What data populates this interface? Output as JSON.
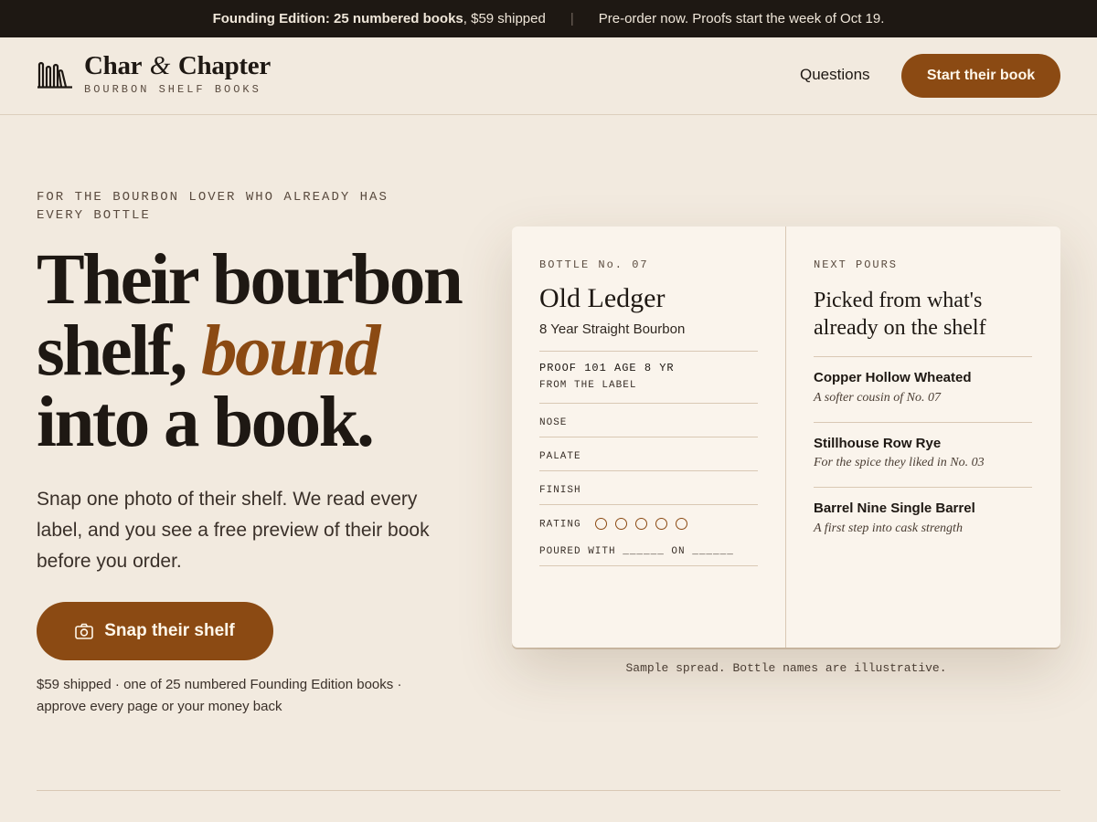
{
  "announcement": {
    "bold": "Founding Edition: 25 numbered books",
    "rest": ", $59 shipped",
    "divider": "|",
    "preorder": "Pre-order now. Proofs start the week of Oct 19."
  },
  "header": {
    "brand_part1": "Char",
    "brand_amp": "&",
    "brand_part2": "Chapter",
    "tagline": "BOURBON SHELF BOOKS",
    "nav_questions": "Questions",
    "cta": "Start their book"
  },
  "hero": {
    "eyebrow": "FOR THE BOURBON LOVER WHO ALREADY HAS EVERY BOTTLE",
    "headline_line1": "Their bourbon",
    "headline_line2_a": "shelf, ",
    "headline_line2_accent": "bound",
    "headline_line3": "into a book.",
    "subcopy": "Snap one photo of their shelf. We read every label, and you see a free preview of their book before you order.",
    "button": "Snap their shelf",
    "fineprint": "$59 shipped · one of 25 numbered Founding Edition books · approve every page or your money back"
  },
  "spread": {
    "left": {
      "bottle_no": "BOTTLE No. 07",
      "name": "Old Ledger",
      "type": "8 Year Straight Bourbon",
      "proof_age": "PROOF 101  AGE 8 YR",
      "from_label": "FROM THE LABEL",
      "nose": "NOSE",
      "palate": "PALATE",
      "finish": "FINISH",
      "rating": "RATING",
      "rating_slots": 5,
      "poured": "POURED WITH ______ ON ______"
    },
    "right": {
      "label": "NEXT POURS",
      "title": "Picked from what's already on the shelf",
      "picks": [
        {
          "name": "Copper Hollow Wheated",
          "note": "A softer cousin of No. 07"
        },
        {
          "name": "Stillhouse Row Rye",
          "note": "For the spice they liked in No. 03"
        },
        {
          "name": "Barrel Nine Single Barrel",
          "note": "A first step into cask strength"
        }
      ]
    },
    "caption": "Sample spread. Bottle names are illustrative."
  },
  "colors": {
    "background": "#f2eadf",
    "dark": "#1e1813",
    "accent": "#8b4a13",
    "page": "#faf4ec"
  },
  "icons": {
    "logo": "books-icon",
    "button": "camera-icon"
  }
}
